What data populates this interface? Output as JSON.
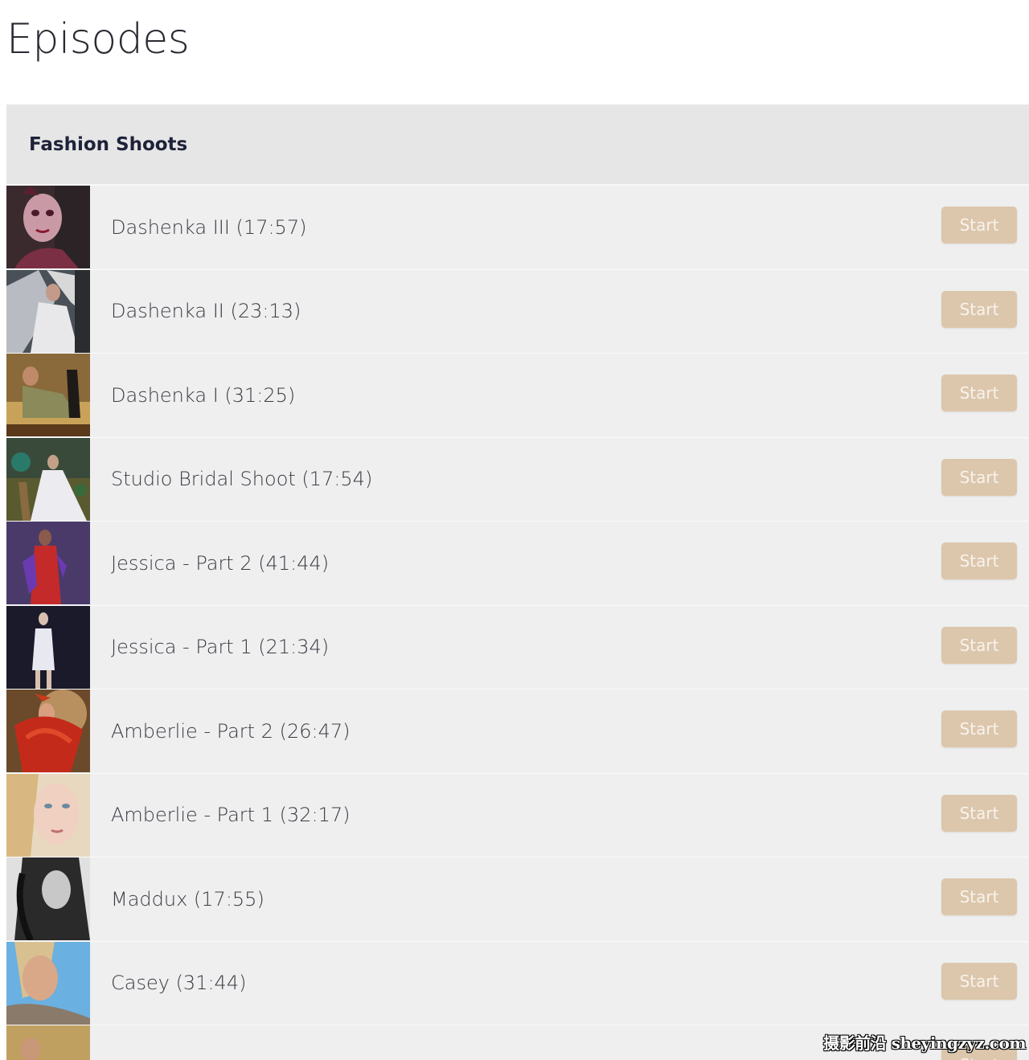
{
  "page": {
    "title": "Episodes"
  },
  "section": {
    "title": "Fashion Shoots",
    "start_label": "Start",
    "colors": {
      "header_bg": "#e6e6e6",
      "row_bg": "#efefef",
      "button_bg": "#dcc7ac",
      "button_text": "#f8f3ec",
      "title_text": "#1e2239"
    }
  },
  "episodes": [
    {
      "title": "Dashenka III (17:57)",
      "start_label": "Start",
      "thumbnail": "dashenka-iii-thumbnail"
    },
    {
      "title": "Dashenka II (23:13)",
      "start_label": "Start",
      "thumbnail": "dashenka-ii-thumbnail"
    },
    {
      "title": "Dashenka I (31:25)",
      "start_label": "Start",
      "thumbnail": "dashenka-i-thumbnail"
    },
    {
      "title": "Studio Bridal Shoot (17:54)",
      "start_label": "Start",
      "thumbnail": "studio-bridal-thumbnail"
    },
    {
      "title": "Jessica - Part 2 (41:44)",
      "start_label": "Start",
      "thumbnail": "jessica-part-2-thumbnail"
    },
    {
      "title": "Jessica - Part 1 (21:34)",
      "start_label": "Start",
      "thumbnail": "jessica-part-1-thumbnail"
    },
    {
      "title": "Amberlie - Part 2 (26:47)",
      "start_label": "Start",
      "thumbnail": "amberlie-part-2-thumbnail"
    },
    {
      "title": "Amberlie - Part 1 (32:17)",
      "start_label": "Start",
      "thumbnail": "amberlie-part-1-thumbnail"
    },
    {
      "title": "Maddux (17:55)",
      "start_label": "Start",
      "thumbnail": "maddux-thumbnail"
    },
    {
      "title": "Casey (31:44)",
      "start_label": "Start",
      "thumbnail": "casey-thumbnail"
    },
    {
      "title": "",
      "start_label": "Start",
      "thumbnail": "partially-visible-thumbnail"
    }
  ],
  "watermark": {
    "text": "摄影前沿 sheyingzyz.com"
  }
}
